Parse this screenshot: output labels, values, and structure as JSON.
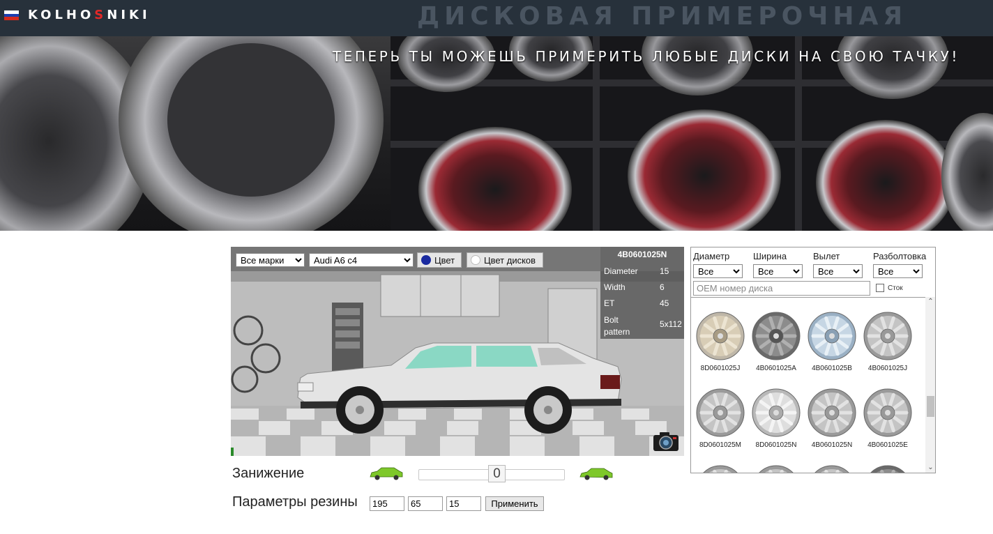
{
  "header": {
    "logo_part1": "KOLHO",
    "logo_red": "S",
    "logo_part2": "NIKI",
    "big_title": "ДИСКОВАЯ ПРИМЕРОЧНАЯ",
    "flag_colors": [
      "#ffffff",
      "#1c3fb0",
      "#d52b1e"
    ]
  },
  "hero": {
    "tagline": "ТЕПЕРЬ ТЫ МОЖЕШЬ ПРИМЕРИТЬ ЛЮБЫЕ ДИСКИ НА СВОЮ ТАЧКУ!"
  },
  "viewer": {
    "brand_select": {
      "value": "Все марки",
      "options": [
        "Все марки"
      ]
    },
    "model_select": {
      "value": "Audi A6 c4",
      "options": [
        "Audi A6 c4"
      ]
    },
    "color_button": {
      "label": "Цвет",
      "dot_color": "#1a2aa0"
    },
    "wheel_color_button": {
      "label": "Цвет дисков",
      "dot_color": "#ffffff"
    },
    "camera_icon": "camera-icon"
  },
  "info": {
    "code": "4B0601025N",
    "rows": [
      {
        "label": "Diameter",
        "value": "15"
      },
      {
        "label": "Width",
        "value": "6"
      },
      {
        "label": "ET",
        "value": "45"
      },
      {
        "label": "Bolt pattern",
        "value": "5x112"
      }
    ]
  },
  "lowering": {
    "label": "Занижение",
    "value": "0",
    "icon_color": "#7ec82a"
  },
  "tires": {
    "label": "Параметры резины",
    "width": "195",
    "profile": "65",
    "diameter": "15",
    "apply_label": "Применить"
  },
  "filters": {
    "diameter": {
      "label": "Диаметр",
      "value": "Все"
    },
    "width": {
      "label": "Ширина",
      "value": "Все"
    },
    "offset": {
      "label": "Вылет",
      "value": "Все"
    },
    "bolt": {
      "label": "Разболтовка",
      "value": "Все"
    },
    "oem_placeholder": "OEM номер диска",
    "stock_label": "Сток"
  },
  "wheels": [
    {
      "code": "8D0601025J",
      "style": "gold"
    },
    {
      "code": "4B0601025A",
      "style": "dark"
    },
    {
      "code": "4B0601025B",
      "style": "blue"
    },
    {
      "code": "4B0601025J",
      "style": "silver"
    },
    {
      "code": "8D0601025M",
      "style": "silver"
    },
    {
      "code": "8D0601025N",
      "style": "bright"
    },
    {
      "code": "4B0601025N",
      "style": "silver"
    },
    {
      "code": "4B0601025E",
      "style": "silver"
    },
    {
      "code": "",
      "style": "silver"
    },
    {
      "code": "",
      "style": "silver"
    },
    {
      "code": "",
      "style": "silver"
    },
    {
      "code": "",
      "style": "dark"
    }
  ]
}
